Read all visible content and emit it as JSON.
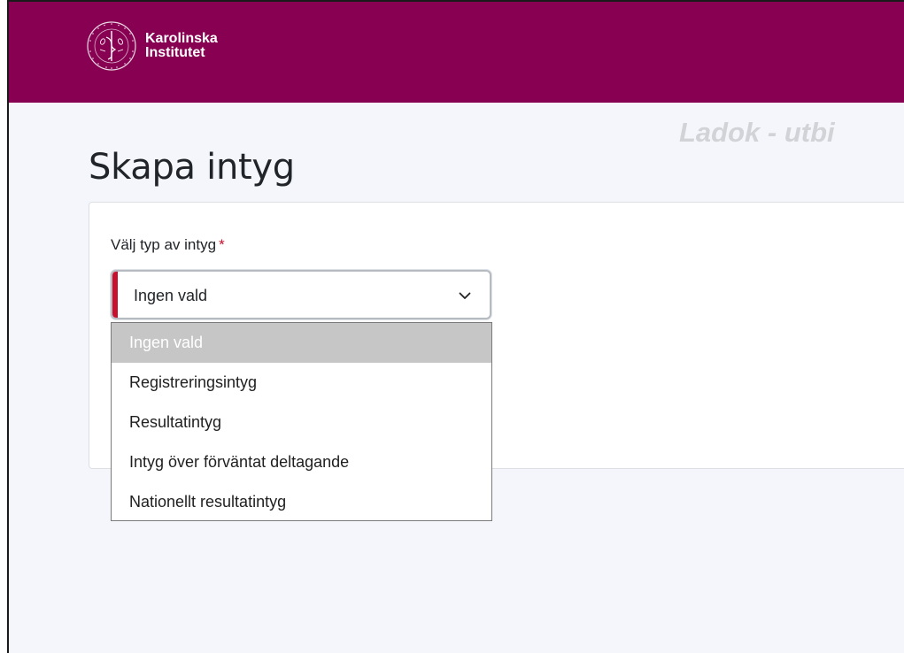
{
  "header": {
    "brand_line1": "Karolinska",
    "brand_line2": "Institutet",
    "seal_text_top": "KAROLINSKA INSTITUTET",
    "seal_text_bottom": "ANNO 1810",
    "background_color": "#870052"
  },
  "environment_label": "Ladok - utbi",
  "page": {
    "title": "Skapa intyg"
  },
  "form": {
    "certificate_type": {
      "label": "Välj typ av intyg",
      "required_marker": "*",
      "selected_value": "Ingen vald",
      "icon": "chevron-down-icon",
      "options": [
        "Ingen vald",
        "Registreringsintyg",
        "Resultatintyg",
        "Intyg över förväntat deltagande",
        "Nationellt resultatintyg"
      ],
      "highlighted_option": "Ingen vald"
    }
  },
  "colors": {
    "brand": "#870052",
    "required": "#c8102e",
    "page_background": "#f4f6fb",
    "highlight": "#c6c6c6"
  }
}
